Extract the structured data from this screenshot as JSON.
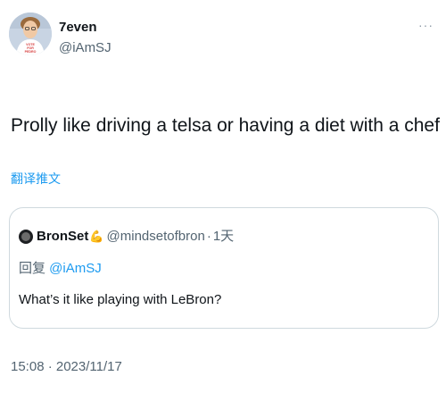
{
  "author": {
    "name": "7even",
    "handle": "@iAmSJ",
    "avatar_shirt_text": "VOTE FOR PEDRO"
  },
  "tweet": {
    "text": "Prolly like driving a telsa or having a diet with a chef",
    "translate_label": "翻译推文",
    "timestamp": "15:08 · 2023/11/17"
  },
  "quoted": {
    "name": "BronSet",
    "badge_icon": "flexed-arm-emoji",
    "handle": "@mindsetofbron",
    "separator": "·",
    "time": "1天",
    "replying_prefix": "回复 ",
    "replying_to": "@iAmSJ",
    "text": "What’s it like playing with LeBron?"
  },
  "icons": {
    "more": "more-options-icon"
  },
  "colors": {
    "link": "#1d9bf0",
    "secondary_text": "#536471",
    "border": "#cfd9de"
  }
}
